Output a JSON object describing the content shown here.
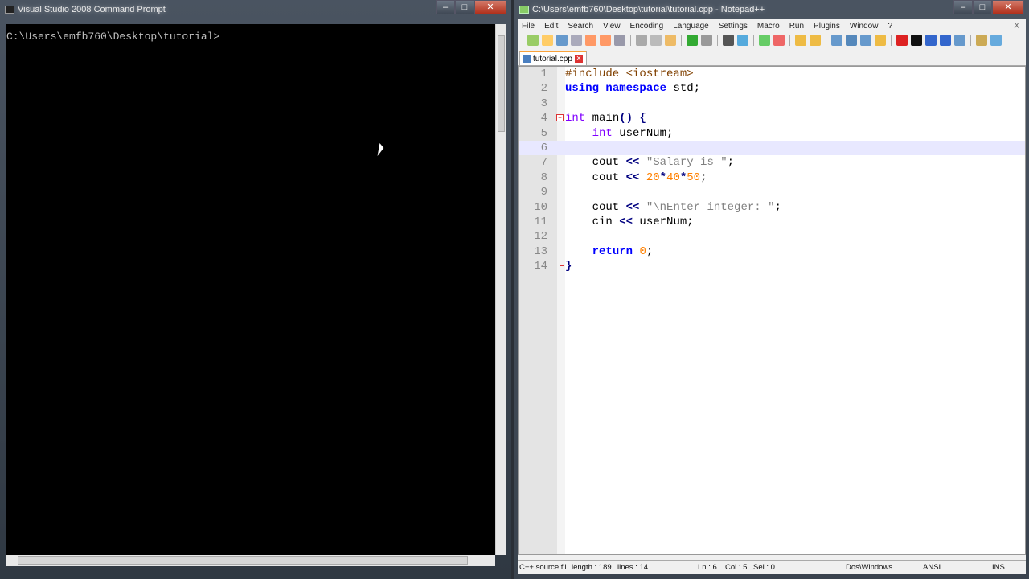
{
  "cmd": {
    "title": "Visual Studio 2008 Command Prompt",
    "prompt": "C:\\Users\\emfb760\\Desktop\\tutorial>"
  },
  "npp": {
    "title": "C:\\Users\\emfb760\\Desktop\\tutorial\\tutorial.cpp - Notepad++",
    "menu": [
      "File",
      "Edit",
      "Search",
      "View",
      "Encoding",
      "Language",
      "Settings",
      "Macro",
      "Run",
      "Plugins",
      "Window",
      "?"
    ],
    "menu_close": "X",
    "tab": "tutorial.cpp",
    "lines": [
      [
        [
          "pp",
          "#include <iostream>"
        ]
      ],
      [
        [
          "kb",
          "using"
        ],
        [
          "df",
          " "
        ],
        [
          "kb",
          "namespace"
        ],
        [
          "df",
          " std;"
        ]
      ],
      [],
      [
        [
          "kw",
          "int"
        ],
        [
          "df",
          " main"
        ],
        [
          "op",
          "()"
        ],
        [
          "df",
          " "
        ],
        [
          "op",
          "{"
        ]
      ],
      [
        [
          "df",
          "    "
        ],
        [
          "kw",
          "int"
        ],
        [
          "df",
          " userNum;"
        ]
      ],
      [],
      [
        [
          "df",
          "    cout "
        ],
        [
          "op",
          "<<"
        ],
        [
          "df",
          " "
        ],
        [
          "st",
          "\"Salary is \""
        ],
        [
          "df",
          ";"
        ]
      ],
      [
        [
          "df",
          "    cout "
        ],
        [
          "op",
          "<<"
        ],
        [
          "df",
          " "
        ],
        [
          "nm",
          "20"
        ],
        [
          "op",
          "*"
        ],
        [
          "nm",
          "40"
        ],
        [
          "op",
          "*"
        ],
        [
          "nm",
          "50"
        ],
        [
          "df",
          ";"
        ]
      ],
      [],
      [
        [
          "df",
          "    cout "
        ],
        [
          "op",
          "<<"
        ],
        [
          "df",
          " "
        ],
        [
          "st",
          "\"\\nEnter integer: \""
        ],
        [
          "df",
          ";"
        ]
      ],
      [
        [
          "df",
          "    cin "
        ],
        [
          "op",
          "<<"
        ],
        [
          "df",
          " userNum;"
        ]
      ],
      [],
      [
        [
          "df",
          "    "
        ],
        [
          "kb",
          "return"
        ],
        [
          "df",
          " "
        ],
        [
          "nm",
          "0"
        ],
        [
          "df",
          ";"
        ]
      ],
      [
        [
          "op",
          "}"
        ]
      ]
    ],
    "current_line": 6,
    "status": {
      "type": "C++ source fil",
      "length": "length : 189",
      "lines": "lines : 14",
      "ln": "Ln : 6",
      "col": "Col : 5",
      "sel": "Sel : 0",
      "eol": "Dos\\Windows",
      "encoding": "ANSI",
      "mode": "INS"
    }
  }
}
